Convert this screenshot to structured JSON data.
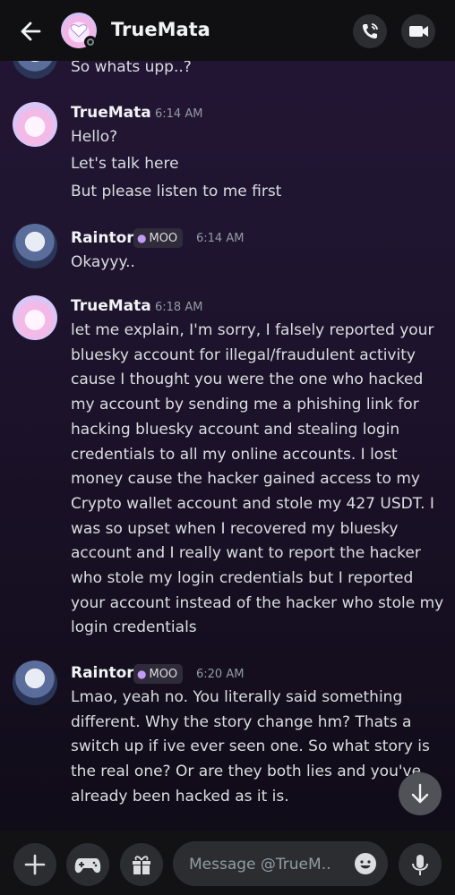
{
  "header": {
    "title": "TrueMata",
    "title_chevron": "›",
    "back_icon": "arrow-left-icon",
    "call_icon": "phone-icon",
    "video_icon": "video-camera-icon"
  },
  "messages": {
    "top_partial": "So whats upp..?",
    "m1": {
      "author": "TrueMata",
      "time": "6:14 AM",
      "lines": [
        "Hello?",
        "Let's talk here",
        "But please listen to me first"
      ]
    },
    "m2": {
      "author": "Raintor",
      "tag": "MOO",
      "time": "6:14 AM",
      "text": "Okayyy.."
    },
    "m3": {
      "author": "TrueMata",
      "time": "6:18 AM",
      "text": "let me explain, I'm sorry, I falsely reported your bluesky account for illegal/fraudulent activity cause I thought you were the one who hacked my account by sending me a phishing link for hacking bluesky  account and stealing login credentials to all my online accounts. I lost money cause the hacker gained access to my Crypto wallet account and stole my 427 USDT. I was so upset when I recovered my bluesky account and I really want to report the hacker who stole my login credentials but I reported your account instead of the hacker who stole my login credentials"
    },
    "m4": {
      "author": "Raintor",
      "tag": "MOO",
      "time": "6:20 AM",
      "text": "Lmao, yeah no. You literally said something different. Why the story change hm? Thats a switch up if ive ever seen one. So what story is the real one? Or are they both lies and you've already been hacked as it is."
    }
  },
  "composer": {
    "placeholder": "Message @TrueM...",
    "value": ""
  },
  "colors": {
    "topbar": "#101012",
    "bottombar": "#121214",
    "button_bg": "#2b2d31",
    "text": "#dbdee1",
    "muted": "#949ba4"
  }
}
